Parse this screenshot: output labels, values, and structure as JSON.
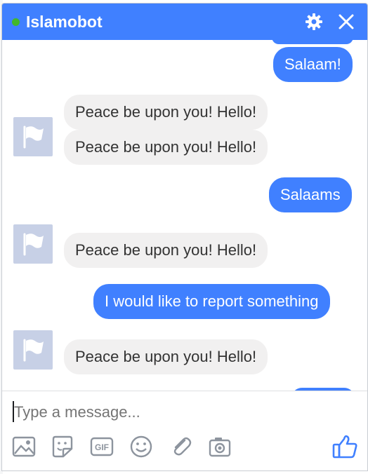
{
  "chat": {
    "title": "Islamobot",
    "status": "online",
    "accent_color": "#4080ff",
    "icons": {
      "settings": "gear-icon",
      "close": "close-icon"
    }
  },
  "messages": [
    {
      "from": "user",
      "text": "Salaam!"
    },
    {
      "from": "bot",
      "text": "Peace be upon you! Hello!"
    },
    {
      "from": "bot",
      "text": "Peace be upon you! Hello!"
    },
    {
      "from": "user",
      "text": "Salaams"
    },
    {
      "from": "bot",
      "text": "Peace be upon you! Hello!"
    },
    {
      "from": "user",
      "text": "I would like to report something"
    },
    {
      "from": "bot",
      "text": "Peace be upon you! Hello!"
    }
  ],
  "composer": {
    "placeholder": "Type a message...",
    "value": "",
    "tools": [
      "image-icon",
      "sticker-icon",
      "gif-icon",
      "emoji-icon",
      "attachment-icon",
      "camera-icon"
    ],
    "send_icon": "thumbs-up-icon"
  }
}
